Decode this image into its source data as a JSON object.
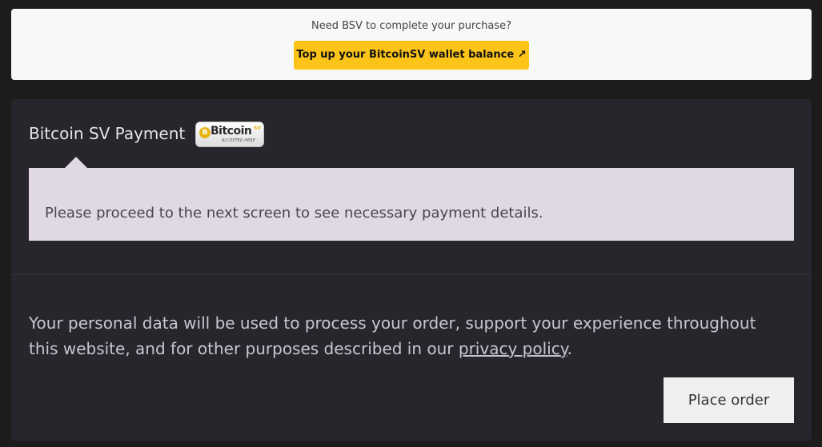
{
  "topup": {
    "prompt": "Need BSV to complete your purchase?",
    "button_label": "Top up your BitcoinSV wallet balance ↗"
  },
  "payment_method": {
    "title": "Bitcoin SV Payment",
    "badge": {
      "word": "Bitcoin",
      "suffix": "SV",
      "tagline": "ACCEPTED HERE",
      "coin_symbol": "B",
      "accent_color": "#e8b30d"
    },
    "info_text": "Please proceed to the next screen to see necessary payment details."
  },
  "privacy": {
    "text_before": "Your personal data will be used to process your order, support your experience throughout this website, and for other purposes described in our ",
    "link_label": "privacy policy",
    "text_after": "."
  },
  "place_order_label": "Place order",
  "colors": {
    "topup_button": "#fcc419",
    "panel_bg": "#28262d",
    "info_bg": "#e0d9e3"
  }
}
